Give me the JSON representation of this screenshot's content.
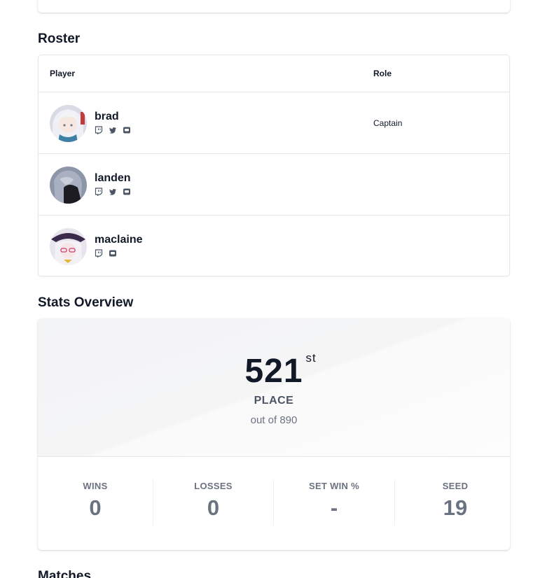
{
  "roster": {
    "title": "Roster",
    "headers": {
      "player": "Player",
      "role": "Role"
    },
    "players": [
      {
        "name": "brad",
        "role": "Captain",
        "socials": [
          "twitch-icon",
          "twitter-icon",
          "discord-icon"
        ]
      },
      {
        "name": "landen",
        "role": "",
        "socials": [
          "twitch-icon",
          "twitter-icon",
          "discord-icon"
        ]
      },
      {
        "name": "maclaine",
        "role": "",
        "socials": [
          "twitch-icon",
          "discord-icon"
        ]
      }
    ]
  },
  "stats": {
    "title": "Stats Overview",
    "place": "521",
    "place_suffix": "st",
    "place_label": "PLACE",
    "out_of": "out of 890",
    "items": [
      {
        "label": "WINS",
        "value": "0"
      },
      {
        "label": "LOSSES",
        "value": "0"
      },
      {
        "label": "SET WIN %",
        "value": "-"
      },
      {
        "label": "SEED",
        "value": "19"
      }
    ]
  },
  "matches": {
    "title": "Matches"
  },
  "colors": {
    "text": "#111827",
    "muted": "#6b7280",
    "border": "#e5e7eb"
  }
}
